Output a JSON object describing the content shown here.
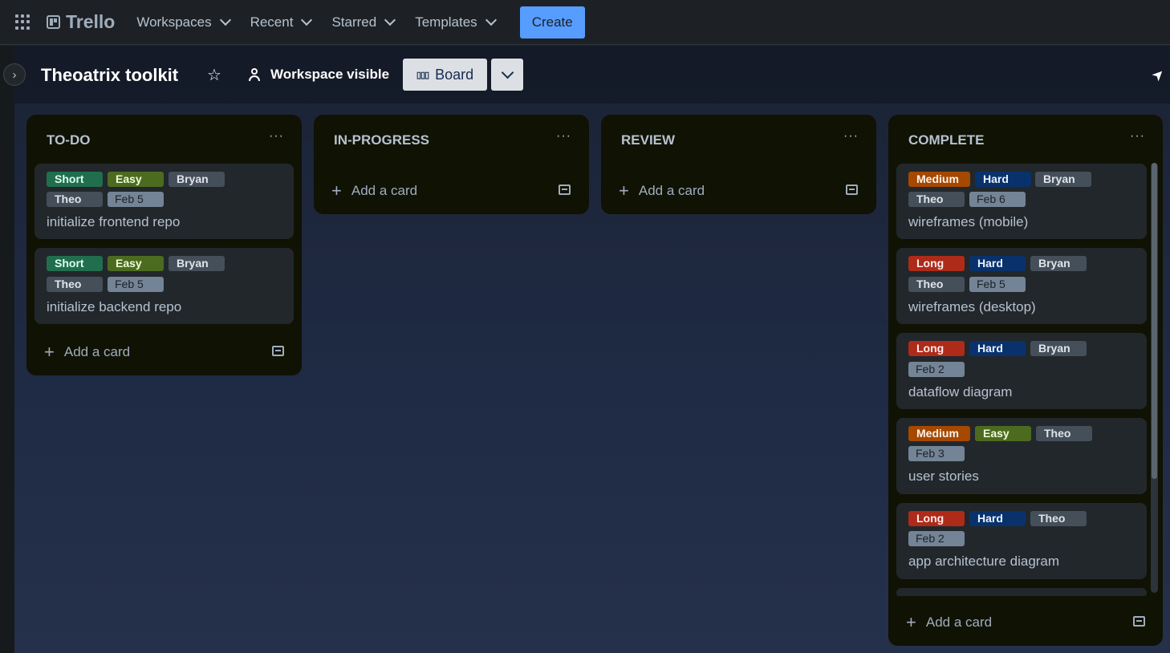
{
  "nav": {
    "brand": "Trello",
    "menu": [
      "Workspaces",
      "Recent",
      "Starred",
      "Templates"
    ],
    "create_label": "Create"
  },
  "board": {
    "title": "Theoatrix toolkit",
    "visibility": "Workspace visible",
    "view_label": "Board"
  },
  "lists": {
    "todo": {
      "title": "TO-DO",
      "cards": [
        {
          "labels": [
            "Short",
            "Easy",
            "Bryan",
            "Theo"
          ],
          "date": "Feb 5",
          "title": "initialize frontend repo"
        },
        {
          "labels": [
            "Short",
            "Easy",
            "Bryan",
            "Theo"
          ],
          "date": "Feb 5",
          "title": "initialize backend repo"
        }
      ],
      "add_label": "Add a card"
    },
    "inprogress": {
      "title": "IN-PROGRESS",
      "add_label": "Add a card"
    },
    "review": {
      "title": "REVIEW",
      "add_label": "Add a card"
    },
    "complete": {
      "title": "COMPLETE",
      "cards": [
        {
          "labels": [
            "Medium",
            "Hard",
            "Bryan",
            "Theo"
          ],
          "date": "Feb 6",
          "title": "wireframes (mobile)"
        },
        {
          "labels": [
            "Long",
            "Hard",
            "Bryan",
            "Theo"
          ],
          "date": "Feb 5",
          "title": "wireframes (desktop)"
        },
        {
          "labels": [
            "Long",
            "Hard",
            "Bryan"
          ],
          "date": "Feb 2",
          "title": "dataflow diagram"
        },
        {
          "labels": [
            "Medium",
            "Easy",
            "Theo"
          ],
          "date": "Feb 3",
          "title": "user stories"
        },
        {
          "labels": [
            "Long",
            "Hard",
            "Theo"
          ],
          "date": "Feb 2",
          "title": "app architecture diagram"
        }
      ],
      "add_label": "Add a card"
    }
  },
  "colors": {
    "short": "#216e4e",
    "easy": "#4c6b1f",
    "medium": "#a54800",
    "long": "#ae2a19",
    "hard": "#09326c",
    "person": "#454f59",
    "date": "#738496",
    "create": "#579dff"
  }
}
